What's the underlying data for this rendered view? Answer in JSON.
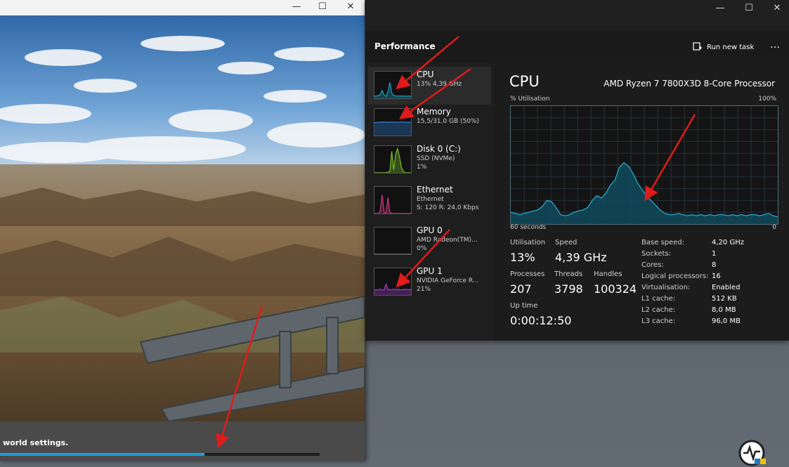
{
  "game_window": {
    "loading_text": "world settings.",
    "progress": 0.64,
    "caption": {
      "minimize": "—",
      "maximize": "☐",
      "close": "✕"
    }
  },
  "task_manager": {
    "caption": {
      "minimize": "—",
      "maximize": "☐",
      "close": "✕"
    },
    "page_title": "Performance",
    "run_new_task": "Run new task",
    "more_icon": "…",
    "sidebar": [
      {
        "name": "CPU",
        "sub1": "13% 4,39 GHz",
        "sub2": "",
        "sub3": "",
        "color": "#1a9ec0"
      },
      {
        "name": "Memory",
        "sub1": "15,5/31,0 GB (50%)",
        "sub2": "",
        "sub3": "",
        "color": "#2f7fd0"
      },
      {
        "name": "Disk 0 (C:)",
        "sub1": "SSD (NVMe)",
        "sub2": "1%",
        "sub3": "",
        "color": "#7cbf2a"
      },
      {
        "name": "Ethernet",
        "sub1": "Ethernet",
        "sub2": "S: 120 R: 24,0 Kbps",
        "sub3": "",
        "color": "#c43a7a"
      },
      {
        "name": "GPU 0",
        "sub1": "AMD Radeon(TM)...",
        "sub2": "0%",
        "sub3": "",
        "color": "#8a8a8a"
      },
      {
        "name": "GPU 1",
        "sub1": "NVIDIA GeForce R...",
        "sub2": "21%",
        "sub3": "",
        "color": "#a23fd0"
      }
    ],
    "detail": {
      "title": "CPU",
      "model": "AMD Ryzen 7 7800X3D 8-Core Processor",
      "util_label": "% Utilisation",
      "util_max": "100%",
      "axis_left": "60 seconds",
      "axis_right": "0",
      "stats": {
        "utilisation_label": "Utilisation",
        "utilisation": "13%",
        "speed_label": "Speed",
        "speed": "4,39 GHz",
        "processes_label": "Processes",
        "processes": "207",
        "threads_label": "Threads",
        "threads": "3798",
        "handles_label": "Handles",
        "handles": "100324",
        "uptime_label": "Up time",
        "uptime": "0:00:12:50"
      },
      "info": [
        {
          "label": "Base speed:",
          "value": "4,20 GHz"
        },
        {
          "label": "Sockets:",
          "value": "1"
        },
        {
          "label": "Cores:",
          "value": "8"
        },
        {
          "label": "Logical processors:",
          "value": "16"
        },
        {
          "label": "Virtualisation:",
          "value": "Enabled"
        },
        {
          "label": "L1 cache:",
          "value": "512 KB"
        },
        {
          "label": "L2 cache:",
          "value": "8,0 MB"
        },
        {
          "label": "L3 cache:",
          "value": "96,0 MB"
        }
      ]
    },
    "cpu_history": [
      10,
      9,
      8,
      9,
      10,
      11,
      12,
      15,
      20,
      19,
      14,
      8,
      7,
      8,
      10,
      11,
      12,
      14,
      20,
      24,
      22,
      26,
      33,
      37,
      48,
      52,
      49,
      43,
      35,
      29,
      24,
      20,
      16,
      12,
      9,
      8,
      8,
      9,
      8,
      7,
      8,
      7,
      8,
      7,
      8,
      7,
      8,
      8,
      7,
      8,
      7,
      8,
      7,
      8,
      8,
      7,
      8,
      9,
      7,
      6
    ]
  },
  "annotation_color": "#e01b1b"
}
